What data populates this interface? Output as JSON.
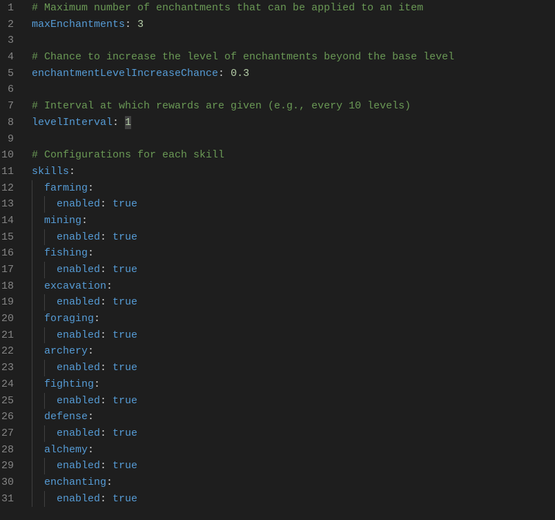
{
  "lines": [
    {
      "n": 1,
      "segs": [
        {
          "cls": "comment",
          "t": "# Maximum number of enchantments that can be applied to an item"
        }
      ]
    },
    {
      "n": 2,
      "segs": [
        {
          "cls": "key",
          "t": "maxEnchantments"
        },
        {
          "cls": "colon",
          "t": ": "
        },
        {
          "cls": "number",
          "t": "3"
        }
      ]
    },
    {
      "n": 3,
      "segs": []
    },
    {
      "n": 4,
      "segs": [
        {
          "cls": "comment",
          "t": "# Chance to increase the level of enchantments beyond the base level"
        }
      ]
    },
    {
      "n": 5,
      "segs": [
        {
          "cls": "key",
          "t": "enchantmentLevelIncreaseChance"
        },
        {
          "cls": "colon",
          "t": ": "
        },
        {
          "cls": "number",
          "t": "0.3"
        }
      ]
    },
    {
      "n": 6,
      "segs": []
    },
    {
      "n": 7,
      "segs": [
        {
          "cls": "comment",
          "t": "# Interval at which rewards are given (e.g., every 10 levels)"
        }
      ]
    },
    {
      "n": 8,
      "segs": [
        {
          "cls": "key",
          "t": "levelInterval"
        },
        {
          "cls": "colon",
          "t": ": "
        },
        {
          "cls": "number sel",
          "t": "1"
        }
      ]
    },
    {
      "n": 9,
      "segs": []
    },
    {
      "n": 10,
      "segs": [
        {
          "cls": "comment",
          "t": "# Configurations for each skill"
        }
      ]
    },
    {
      "n": 11,
      "segs": [
        {
          "cls": "key",
          "t": "skills"
        },
        {
          "cls": "colon",
          "t": ":"
        }
      ]
    },
    {
      "n": 12,
      "guides": 1,
      "segs": [
        {
          "cls": "key",
          "t": "farming"
        },
        {
          "cls": "colon",
          "t": ":"
        }
      ]
    },
    {
      "n": 13,
      "guides": 2,
      "segs": [
        {
          "cls": "key",
          "t": "enabled"
        },
        {
          "cls": "colon",
          "t": ": "
        },
        {
          "cls": "bool",
          "t": "true"
        }
      ]
    },
    {
      "n": 14,
      "guides": 1,
      "segs": [
        {
          "cls": "key",
          "t": "mining"
        },
        {
          "cls": "colon",
          "t": ":"
        }
      ]
    },
    {
      "n": 15,
      "guides": 2,
      "segs": [
        {
          "cls": "key",
          "t": "enabled"
        },
        {
          "cls": "colon",
          "t": ": "
        },
        {
          "cls": "bool",
          "t": "true"
        }
      ]
    },
    {
      "n": 16,
      "guides": 1,
      "segs": [
        {
          "cls": "key",
          "t": "fishing"
        },
        {
          "cls": "colon",
          "t": ":"
        }
      ]
    },
    {
      "n": 17,
      "guides": 2,
      "segs": [
        {
          "cls": "key",
          "t": "enabled"
        },
        {
          "cls": "colon",
          "t": ": "
        },
        {
          "cls": "bool",
          "t": "true"
        }
      ]
    },
    {
      "n": 18,
      "guides": 1,
      "segs": [
        {
          "cls": "key",
          "t": "excavation"
        },
        {
          "cls": "colon",
          "t": ":"
        }
      ]
    },
    {
      "n": 19,
      "guides": 2,
      "segs": [
        {
          "cls": "key",
          "t": "enabled"
        },
        {
          "cls": "colon",
          "t": ": "
        },
        {
          "cls": "bool",
          "t": "true"
        }
      ]
    },
    {
      "n": 20,
      "guides": 1,
      "segs": [
        {
          "cls": "key",
          "t": "foraging"
        },
        {
          "cls": "colon",
          "t": ":"
        }
      ]
    },
    {
      "n": 21,
      "guides": 2,
      "segs": [
        {
          "cls": "key",
          "t": "enabled"
        },
        {
          "cls": "colon",
          "t": ": "
        },
        {
          "cls": "bool",
          "t": "true"
        }
      ]
    },
    {
      "n": 22,
      "guides": 1,
      "segs": [
        {
          "cls": "key",
          "t": "archery"
        },
        {
          "cls": "colon",
          "t": ":"
        }
      ]
    },
    {
      "n": 23,
      "guides": 2,
      "segs": [
        {
          "cls": "key",
          "t": "enabled"
        },
        {
          "cls": "colon",
          "t": ": "
        },
        {
          "cls": "bool",
          "t": "true"
        }
      ]
    },
    {
      "n": 24,
      "guides": 1,
      "segs": [
        {
          "cls": "key",
          "t": "fighting"
        },
        {
          "cls": "colon",
          "t": ":"
        }
      ]
    },
    {
      "n": 25,
      "guides": 2,
      "segs": [
        {
          "cls": "key",
          "t": "enabled"
        },
        {
          "cls": "colon",
          "t": ": "
        },
        {
          "cls": "bool",
          "t": "true"
        }
      ]
    },
    {
      "n": 26,
      "guides": 1,
      "segs": [
        {
          "cls": "key",
          "t": "defense"
        },
        {
          "cls": "colon",
          "t": ":"
        }
      ]
    },
    {
      "n": 27,
      "guides": 2,
      "segs": [
        {
          "cls": "key",
          "t": "enabled"
        },
        {
          "cls": "colon",
          "t": ": "
        },
        {
          "cls": "bool",
          "t": "true"
        }
      ]
    },
    {
      "n": 28,
      "guides": 1,
      "segs": [
        {
          "cls": "key",
          "t": "alchemy"
        },
        {
          "cls": "colon",
          "t": ":"
        }
      ]
    },
    {
      "n": 29,
      "guides": 2,
      "segs": [
        {
          "cls": "key",
          "t": "enabled"
        },
        {
          "cls": "colon",
          "t": ": "
        },
        {
          "cls": "bool",
          "t": "true"
        }
      ]
    },
    {
      "n": 30,
      "guides": 1,
      "segs": [
        {
          "cls": "key",
          "t": "enchanting"
        },
        {
          "cls": "colon",
          "t": ":"
        }
      ]
    },
    {
      "n": 31,
      "guides": 2,
      "segs": [
        {
          "cls": "key",
          "t": "enabled"
        },
        {
          "cls": "colon",
          "t": ": "
        },
        {
          "cls": "bool",
          "t": "true"
        }
      ]
    }
  ],
  "colors": {
    "background": "#1e1e1e",
    "comment": "#6a9955",
    "key": "#569cd6",
    "number": "#b5cea8",
    "gutter": "#858585"
  }
}
